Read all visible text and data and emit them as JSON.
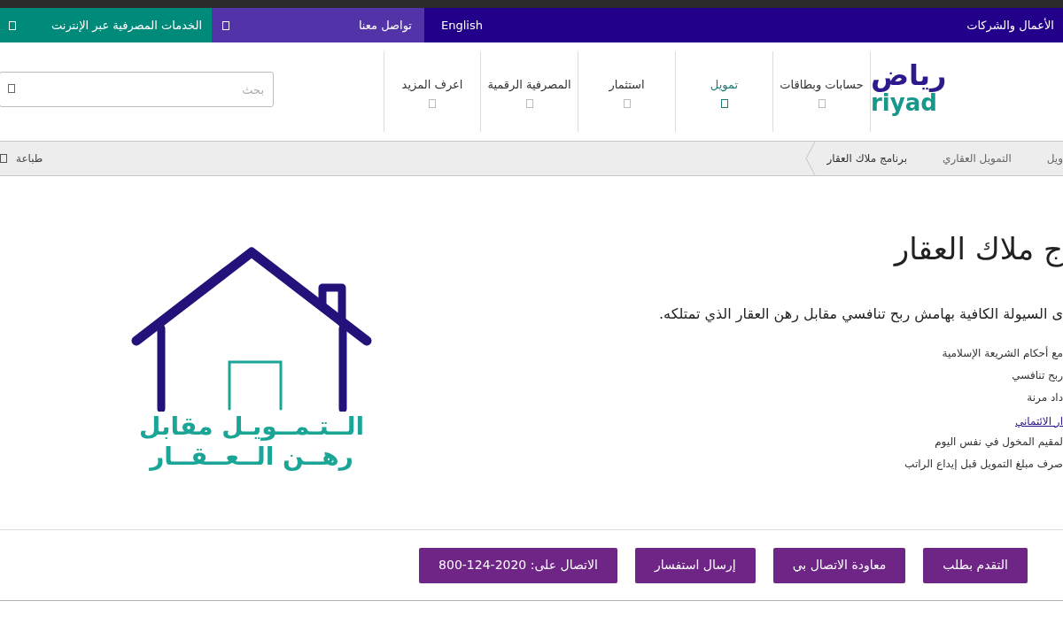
{
  "top_bar": {
    "business_link": "الأعمال والشركات",
    "language_link": "English",
    "contact_link": "تواصل معنا",
    "online_banking_link": "الخدمات المصرفية عبر الإنترنت"
  },
  "logo": {
    "arabic": "رياض",
    "latin": "riyad"
  },
  "nav": [
    {
      "label": "حسابات وبطاقات",
      "selected": false
    },
    {
      "label": "تمويل",
      "selected": true
    },
    {
      "label": "استثمار",
      "selected": false
    },
    {
      "label": "المصرفية الرقمية",
      "selected": false
    },
    {
      "label": "اعرف المزيد",
      "selected": false
    }
  ],
  "search": {
    "placeholder": "بحث"
  },
  "breadcrumb": [
    {
      "label": "ويل",
      "current": false
    },
    {
      "label": "التمويل العقاري",
      "current": false
    },
    {
      "label": "برنامج ملاك العقار",
      "current": true
    }
  ],
  "print_link": "طباعة",
  "heading": "ج ملاك العقار",
  "intro": "ى السيولة الكافية بهامش ربح تنافسي مقابل رهن العقار الذي تمتلكه.",
  "features": [
    {
      "kind": "text",
      "text": "مع أحكام الشريعة الإسلامية"
    },
    {
      "kind": "text",
      "text": "ربح تنافسي"
    },
    {
      "kind": "text",
      "text": "داد مرنة"
    },
    {
      "kind": "link",
      "text": "ار الائتماني"
    },
    {
      "kind": "text",
      "text": "لمقيم المخول في نفس اليوم"
    },
    {
      "kind": "text",
      "text": "صرف مبلغ التمويل قبل إيداع الراتب"
    }
  ],
  "illustration": {
    "lines": [
      "الــتـمــويـل مقابل",
      "رهــن الــعــقــار"
    ]
  },
  "buttons": [
    {
      "label": "التقدم بطلب"
    },
    {
      "label": "معاودة الاتصال بي"
    },
    {
      "label": "إرسال استفسار"
    },
    {
      "label": "الاتصال على:",
      "phone": "800-124-2020"
    }
  ]
}
